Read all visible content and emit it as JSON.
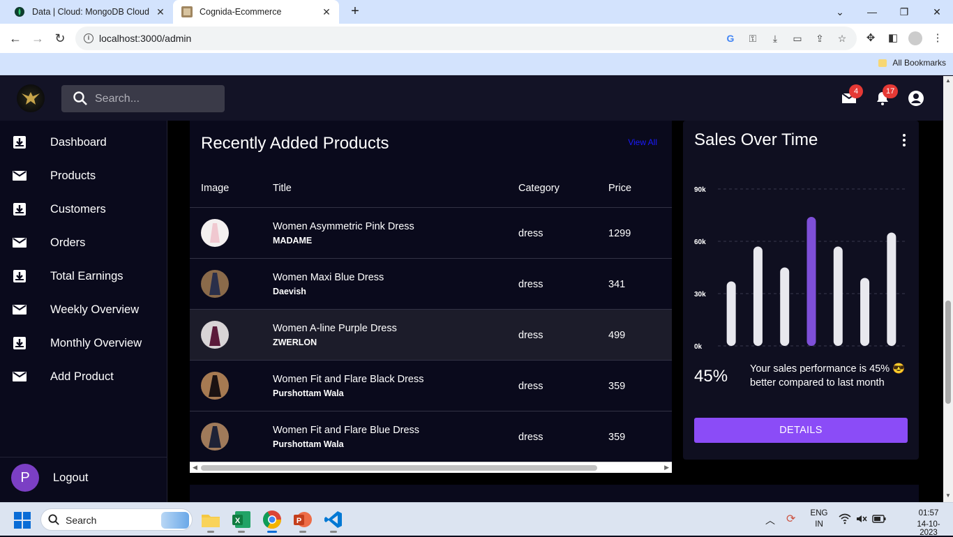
{
  "browser": {
    "tabs": [
      {
        "title": "Data | Cloud: MongoDB Cloud",
        "icon": "mongodb-leaf-icon"
      },
      {
        "title": "Cognida-Ecommerce",
        "icon": "site-favicon"
      }
    ],
    "url": "localhost:3000/admin",
    "bookmarks_label": "All Bookmarks"
  },
  "header": {
    "search_placeholder": "Search...",
    "mail_count": "4",
    "notif_count": "17"
  },
  "sidebar": {
    "items": [
      {
        "label": "Dashboard",
        "icon": "download-box-icon"
      },
      {
        "label": "Products",
        "icon": "mail-icon"
      },
      {
        "label": "Customers",
        "icon": "download-box-icon"
      },
      {
        "label": "Orders",
        "icon": "mail-icon"
      },
      {
        "label": "Total Earnings",
        "icon": "download-box-icon"
      },
      {
        "label": "Weekly Overview",
        "icon": "mail-icon"
      },
      {
        "label": "Monthly Overview",
        "icon": "download-box-icon"
      },
      {
        "label": "Add Product",
        "icon": "mail-icon"
      }
    ],
    "logout": {
      "avatar_letter": "P",
      "label": "Logout"
    }
  },
  "products": {
    "title": "Recently Added Products",
    "view_all": "View All",
    "columns": [
      "Image",
      "Title",
      "Category",
      "Price"
    ],
    "rows": [
      {
        "title": "Women Asymmetric Pink Dress",
        "brand": "MADAME",
        "category": "dress",
        "price": "1299",
        "img_color": "#f0c8d0"
      },
      {
        "title": "Women Maxi Blue Dress",
        "brand": "Daevish",
        "category": "dress",
        "price": "341",
        "img_color": "#2a2f4a"
      },
      {
        "title": "Women A-line Purple Dress",
        "brand": "ZWERLON",
        "category": "dress",
        "price": "499",
        "img_color": "#5a1a3a"
      },
      {
        "title": "Women Fit and Flare Black Dress",
        "brand": "Purshottam Wala",
        "category": "dress",
        "price": "359",
        "img_color": "#1a1212"
      },
      {
        "title": "Women Fit and Flare Blue Dress",
        "brand": "Purshottam Wala",
        "category": "dress",
        "price": "359",
        "img_color": "#1e2236"
      }
    ]
  },
  "sales": {
    "title": "Sales Over Time",
    "percent": "45%",
    "message": "Your sales performance is 45% 😎 better compared to last month",
    "details_button": "DETAILS"
  },
  "chart_data": {
    "type": "bar",
    "categories": [
      "",
      "",
      "",
      "",
      "",
      "",
      ""
    ],
    "values": [
      37,
      57,
      45,
      74,
      57,
      39,
      65
    ],
    "ylim": [
      0,
      90
    ],
    "ytick_labels": [
      "0k",
      "30k",
      "60k",
      "90k"
    ],
    "grid": true,
    "highlight_index": 3,
    "colors": {
      "bar": "#e8e8ee",
      "highlight": "#7e4fd8"
    }
  },
  "taskbar": {
    "search_label": "Search",
    "lang": "ENG",
    "region": "IN",
    "time": "01:57",
    "date": "14-10-2023"
  }
}
